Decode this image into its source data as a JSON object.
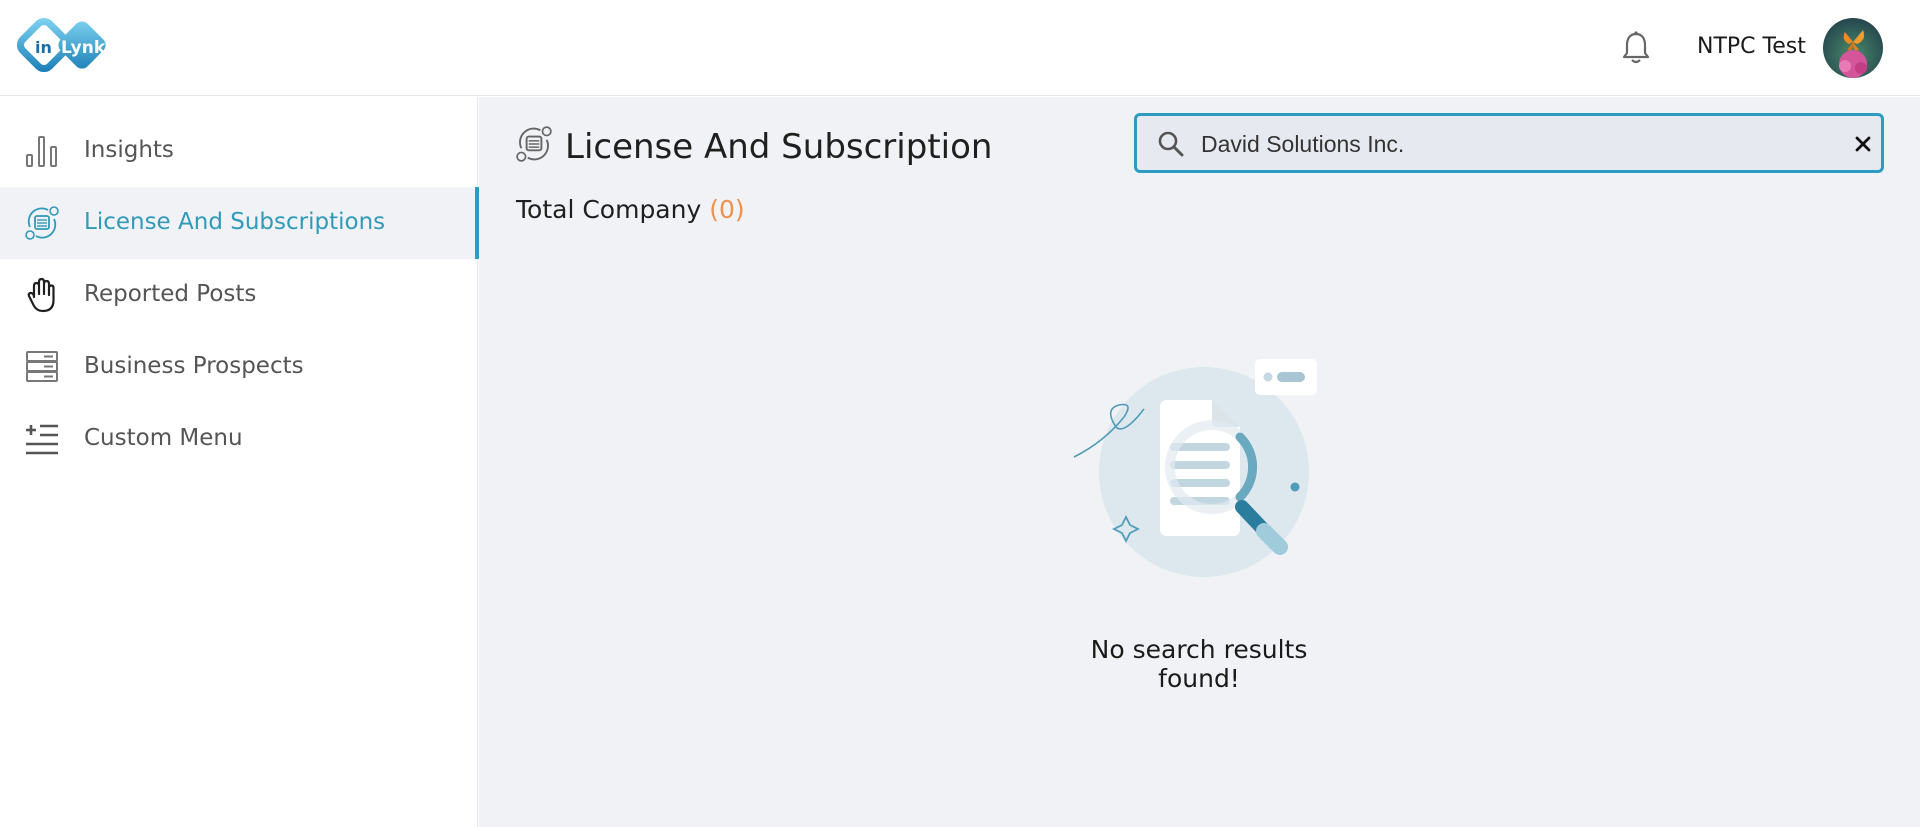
{
  "header": {
    "logo_text": "inLynk",
    "username": "NTPC Test",
    "bell_icon": "bell-icon",
    "avatar_icon": "avatar"
  },
  "sidebar": {
    "items": [
      {
        "label": "Insights",
        "icon": "bar-chart-icon",
        "active": false
      },
      {
        "label": "License And Subscriptions",
        "icon": "license-icon",
        "active": true
      },
      {
        "label": "Reported Posts",
        "icon": "hand-icon",
        "active": false
      },
      {
        "label": "Business Prospects",
        "icon": "server-icon",
        "active": false
      },
      {
        "label": "Custom Menu",
        "icon": "add-list-icon",
        "active": false
      }
    ]
  },
  "main": {
    "title": "License And Subscription",
    "total_label": "Total Company",
    "total_count": "(0)",
    "search": {
      "value": "David Solutions Inc.",
      "placeholder": ""
    },
    "empty_message": "No search results found!"
  },
  "colors": {
    "accent": "#2d9cc0",
    "count_orange": "#f0904a",
    "main_bg": "#f0f2f5"
  }
}
